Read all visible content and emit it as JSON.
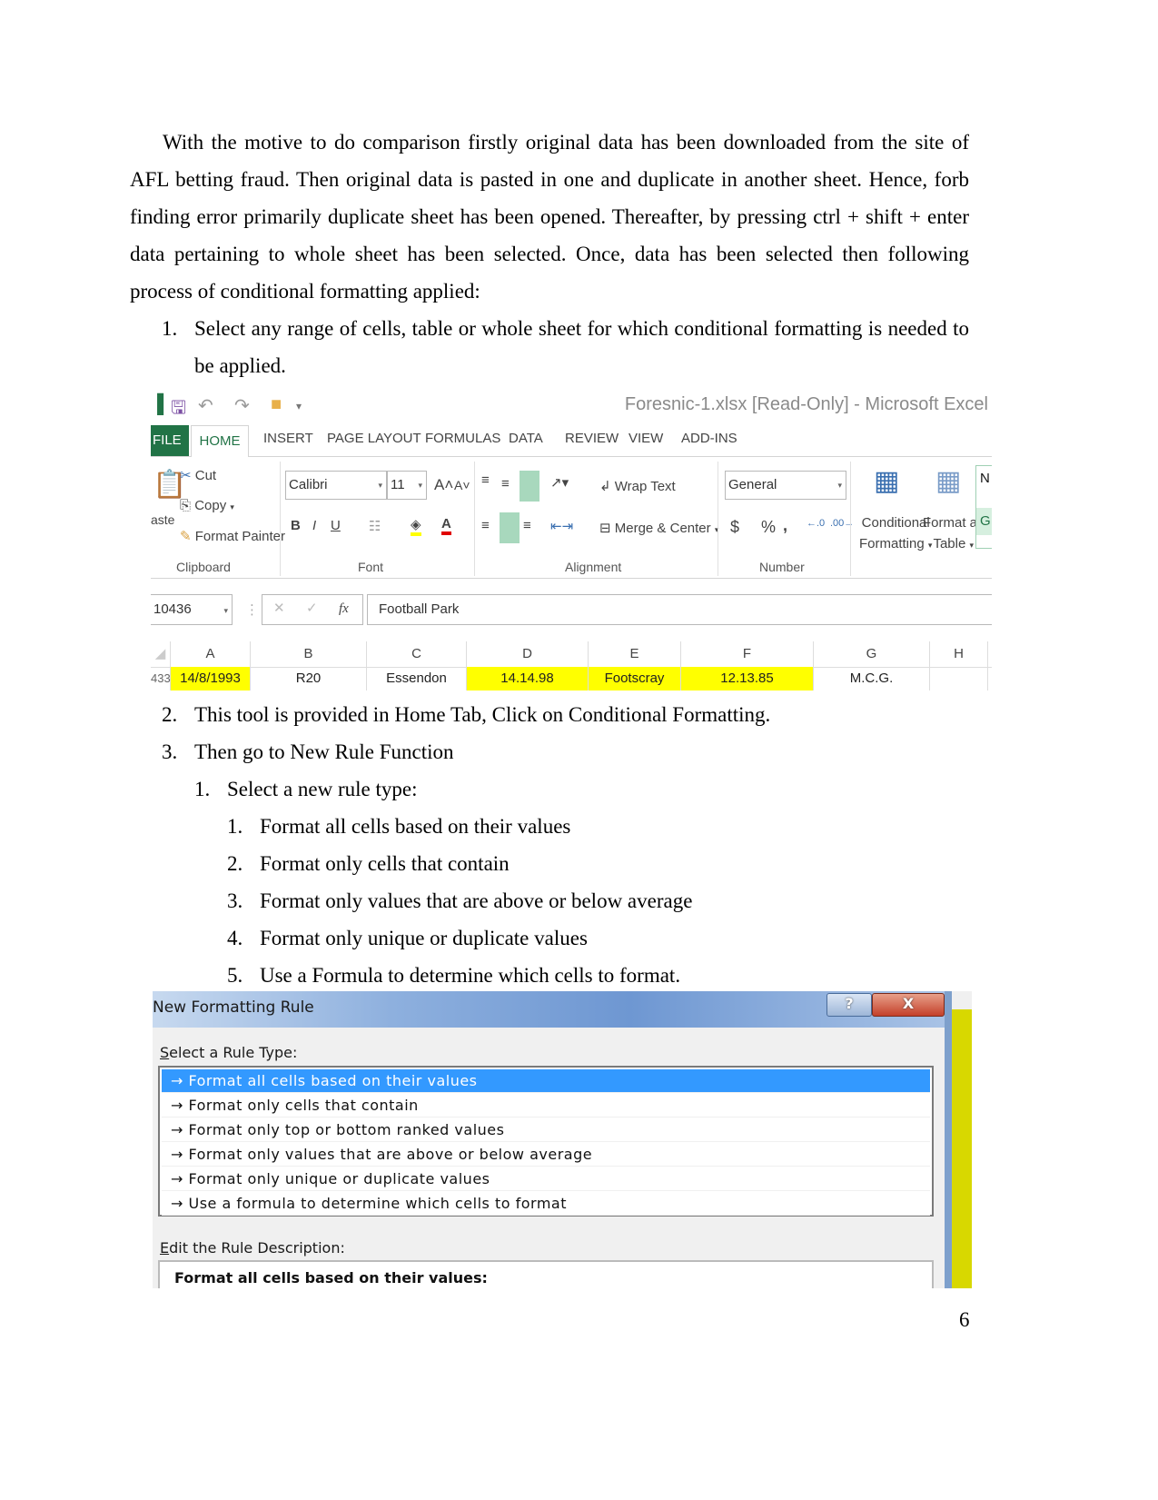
{
  "intro_paragraph": "With the motive to do comparison firstly original data has been downloaded from the site of AFL betting fraud. Then original data is pasted in one and duplicate in another sheet. Hence, forb finding error primarily duplicate sheet has been opened. Thereafter, by pressing ctrl + shift + enter data pertaining to whole sheet has been selected. Once, data has been selected then following process of conditional formatting applied:",
  "steps": [
    {
      "num": "1.",
      "text": "Select any range of cells, table or whole sheet for which conditional formatting is needed to be applied."
    },
    {
      "num": "2.",
      "text": "This tool is provided in Home Tab, Click on Conditional Formatting."
    },
    {
      "num": "3.",
      "text": "Then go to New Rule Function"
    }
  ],
  "substep": {
    "num": "1.",
    "text": "Select a new rule type:"
  },
  "rule_types": [
    {
      "num": "1.",
      "text": "Format all cells based on their values"
    },
    {
      "num": "2.",
      "text": "Format only cells that contain"
    },
    {
      "num": "3.",
      "text": "Format only values that are above or below average"
    },
    {
      "num": "4.",
      "text": "Format only unique or duplicate values"
    },
    {
      "num": "5.",
      "text": "Use a Formula to determine which cells to format."
    }
  ],
  "excel": {
    "window_title": "Foresnic-1.xlsx  [Read-Only] - Microsoft Excel",
    "tabs": [
      "FILE",
      "HOME",
      "INSERT",
      "PAGE LAYOUT",
      "FORMULAS",
      "DATA",
      "REVIEW",
      "VIEW",
      "ADD-INS"
    ],
    "clipboard": {
      "paste": "aste",
      "cut": "Cut",
      "copy": "Copy",
      "format_painter": "Format Painter",
      "group": "Clipboard"
    },
    "font": {
      "name": "Calibri",
      "size": "11",
      "bold": "B",
      "italic": "I",
      "underline": "U",
      "group": "Font"
    },
    "alignment": {
      "wrap_text": "Wrap Text",
      "merge_center": "Merge & Center",
      "group": "Alignment"
    },
    "number": {
      "format": "General",
      "currency": "$",
      "percent": "%",
      "comma": ",",
      "group": "Number"
    },
    "styles": {
      "conditional_formatting_1": "Conditional",
      "conditional_formatting_2": "Formatting",
      "format_table_1": "Format as",
      "format_table_2": "Table",
      "cut_off_1": "N",
      "cut_off_2": "G"
    },
    "name_box": "10436",
    "formula_value": "Football Park",
    "fx": "fx",
    "columns": [
      "A",
      "B",
      "C",
      "D",
      "E",
      "F",
      "G",
      "H"
    ],
    "row_number": "433",
    "row_cells": [
      "14/8/1993",
      "R20",
      "Essendon",
      "14.14.98",
      "Footscray",
      "12.13.85",
      "M.C.G.",
      ""
    ],
    "highlight_color": "#ffff00",
    "accent_color": "#217346"
  },
  "dialog": {
    "title": "New Formatting Rule",
    "help": "?",
    "close": "X",
    "select_label": "Select a Rule Type:",
    "rule_items": [
      "Format all cells based on their values",
      "Format only cells that contain",
      "Format only top or bottom ranked values",
      "Format only values that are above or below average",
      "Format only unique or duplicate values",
      "Use a formula to determine which cells to format"
    ],
    "selected_index": 0,
    "edit_label": "Edit the Rule Description:",
    "description_heading": "Format all cells based on their values:",
    "selection_color": "#3399ff"
  },
  "page_number": "6"
}
